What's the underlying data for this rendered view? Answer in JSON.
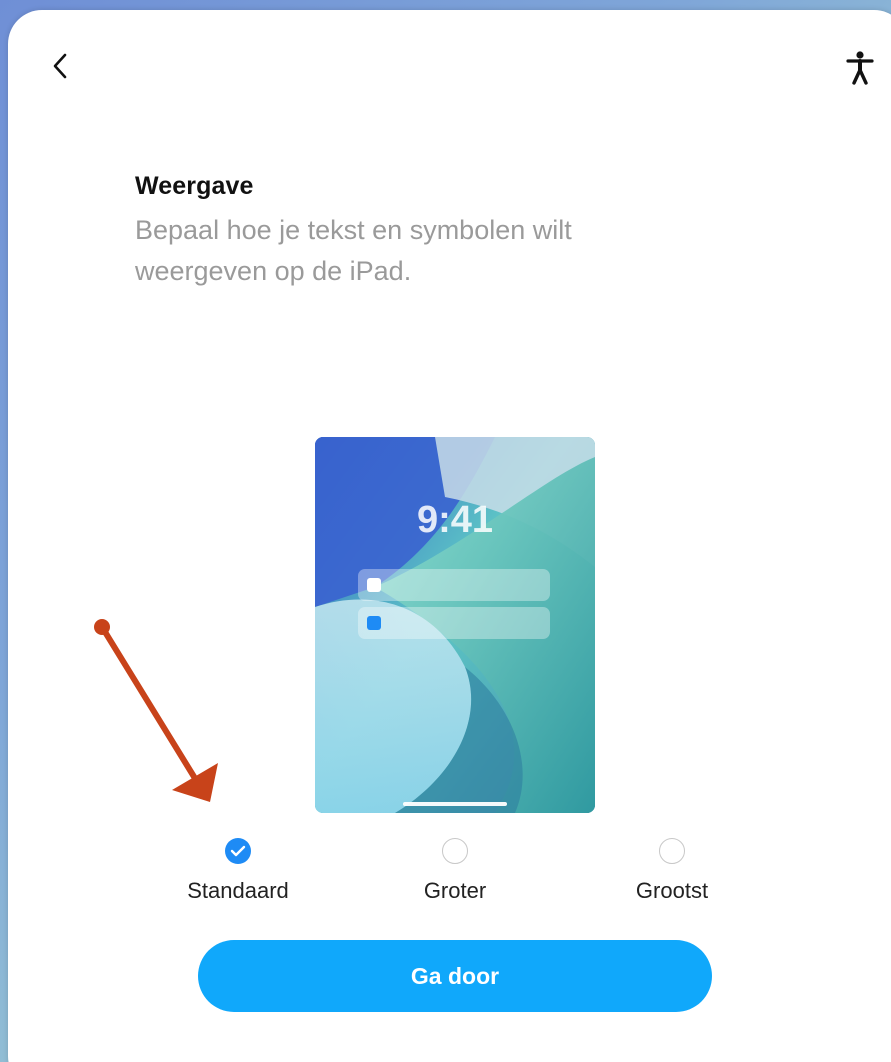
{
  "header": {
    "back_icon": "chevron-left-icon",
    "accessibility_icon": "accessibility-person-icon"
  },
  "content": {
    "title": "Weergave",
    "subtitle": "Bepaal hoe je tekst en symbolen wilt weergeven op de iPad."
  },
  "preview": {
    "clock": "9:41"
  },
  "options": [
    {
      "label": "Standaard",
      "selected": true
    },
    {
      "label": "Groter",
      "selected": false
    },
    {
      "label": "Grootst",
      "selected": false
    }
  ],
  "continue_label": "Ga door",
  "colors": {
    "accent": "#10a8fb",
    "radio_checked": "#1e8bf5",
    "annotation_arrow": "#c8431a"
  }
}
